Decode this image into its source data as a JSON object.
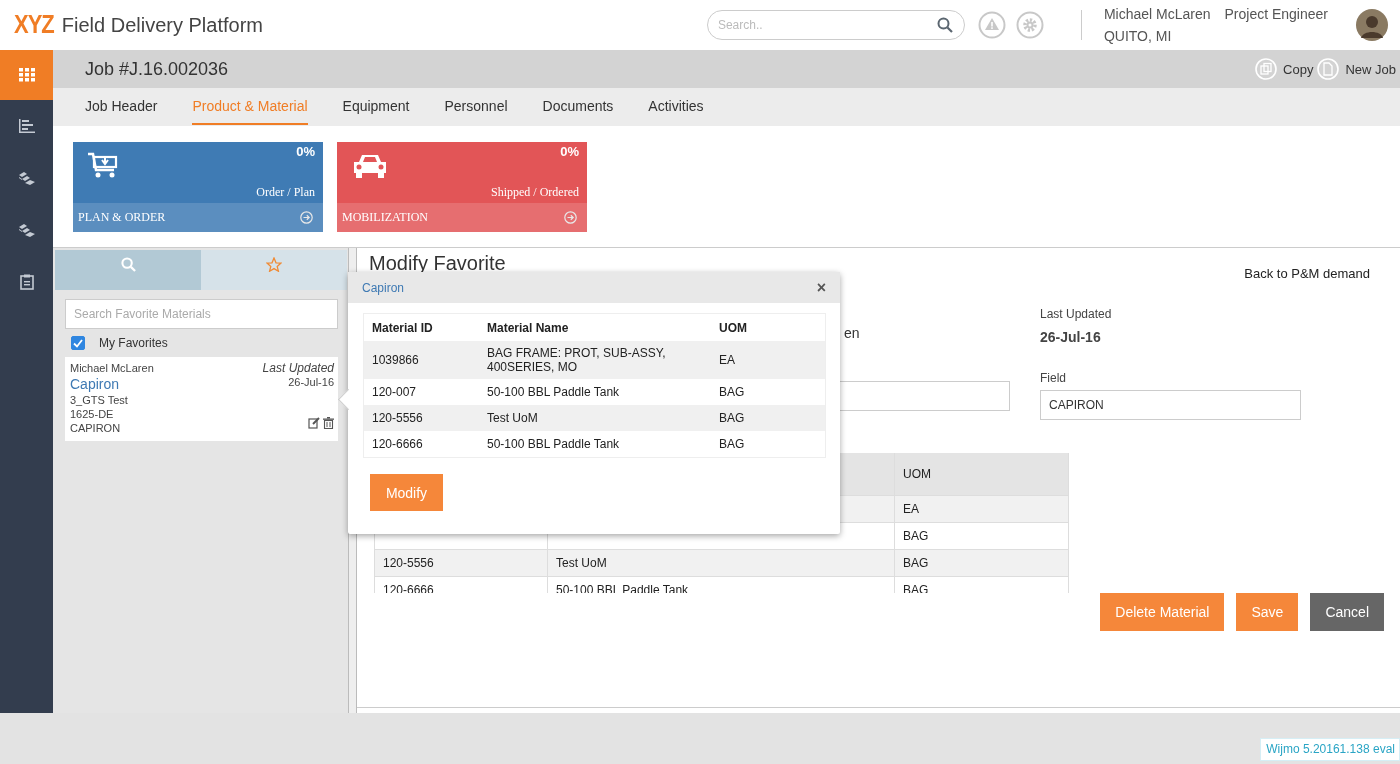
{
  "app": {
    "logo": "XYZ",
    "title": "Field Delivery Platform"
  },
  "search": {
    "placeholder": "Search.."
  },
  "user": {
    "name": "Michael McLaren",
    "role": "Project Engineer",
    "location": "QUITO, MI"
  },
  "nav": [
    {
      "kind": "apps",
      "selected": true
    },
    {
      "kind": "bars",
      "selected": false
    },
    {
      "kind": "layers",
      "selected": false
    },
    {
      "kind": "layers",
      "selected": false
    },
    {
      "kind": "clipboard",
      "selected": false
    }
  ],
  "job": {
    "title": "Job #J.16.002036",
    "actions": [
      {
        "kind": "copy",
        "label": "Copy"
      },
      {
        "kind": "new",
        "label": "New Job"
      }
    ]
  },
  "tabs": [
    {
      "label": "Job Header",
      "selected": false
    },
    {
      "label": "Product & Material",
      "selected": true
    },
    {
      "label": "Equipment",
      "selected": false
    },
    {
      "label": "Personnel",
      "selected": false
    },
    {
      "label": "Documents",
      "selected": false
    },
    {
      "label": "Activities",
      "selected": false
    }
  ],
  "tiles": [
    {
      "kind": "cart",
      "percent": "0%",
      "caption": "Order / Plan",
      "label": "PLAN & ORDER",
      "color": "#3f7bb4"
    },
    {
      "kind": "car",
      "percent": "0%",
      "caption": "Shipped / Ordered",
      "label": "MOBILIZATION",
      "color": "#e25557"
    }
  ],
  "favorites": {
    "tabs": [
      {
        "kind": "search",
        "selected": false
      },
      {
        "kind": "star",
        "selected": true
      }
    ],
    "placeholder": "Search Favorite Materials",
    "filter": {
      "label": "My Favorites",
      "checked": true
    },
    "items": [
      {
        "owner": "Michael McLaren",
        "name": "Capiron",
        "updated_label": "Last Updated",
        "updated": "26-Jul-16",
        "lines": [
          "3_GTS Test",
          "1625-DE",
          "CAPIRON"
        ]
      }
    ]
  },
  "detail": {
    "title": "Modify Favorite",
    "back_link": "Back to P&M demand",
    "owner_fragment": "en",
    "last_updated_label": "Last Updated",
    "last_updated": "26-Jul-16",
    "field_label": "Field",
    "field_value": "CAPIRON",
    "table": {
      "uom_header": "UOM",
      "rows": [
        {
          "uom": "EA"
        },
        {
          "uom": "BAG"
        },
        {
          "id": "120-5556",
          "name": "Test UoM",
          "uom": "BAG"
        },
        {
          "id": "120-6666",
          "name": "50-100 BBL Paddle Tank",
          "uom": "BAG"
        }
      ]
    },
    "buttons": [
      {
        "label": "Delete Material",
        "kind": "primary"
      },
      {
        "label": "Save",
        "kind": "primary"
      },
      {
        "label": "Cancel",
        "kind": "secondary"
      }
    ]
  },
  "popup": {
    "title": "Capiron",
    "close": "×",
    "columns": [
      "Material ID",
      "Material Name",
      "UOM"
    ],
    "rows": [
      [
        "1039866",
        "BAG FRAME: PROT, SUB-ASSY, 400SERIES, MO",
        "EA"
      ],
      [
        "120-007",
        "50-100 BBL Paddle Tank",
        "BAG"
      ],
      [
        "120-5556",
        "Test UoM",
        "BAG"
      ],
      [
        "120-6666",
        "50-100 BBL Paddle Tank",
        "BAG"
      ]
    ],
    "button": "Modify"
  },
  "footer": {
    "badge": "Wijmo 5.20161.138 eval"
  }
}
